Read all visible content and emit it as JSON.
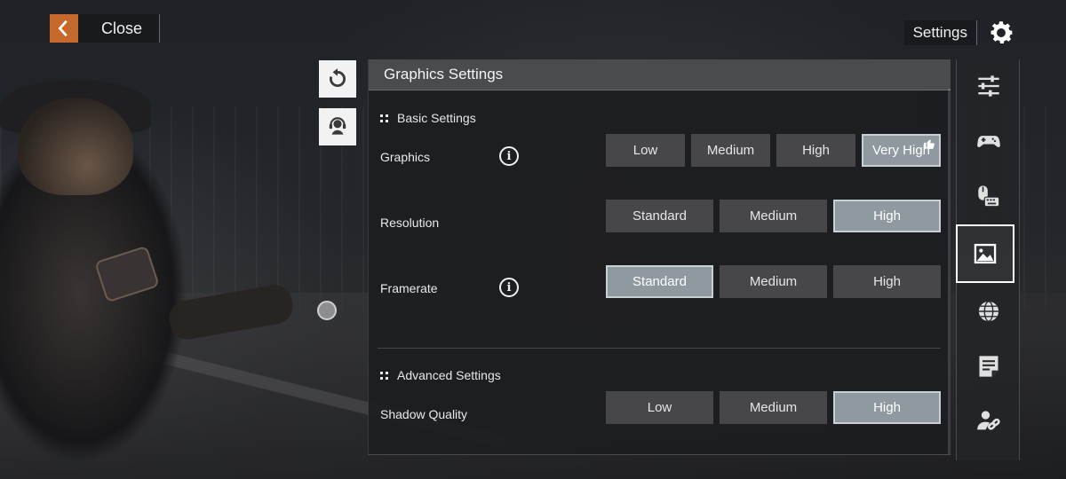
{
  "top_bar": {
    "close_label": "Close",
    "settings_label": "Settings"
  },
  "panel": {
    "title": "Graphics Settings",
    "basic_section": "Basic Settings",
    "advanced_section": "Advanced Settings",
    "info_glyph": "i",
    "rows": {
      "graphics": {
        "label": "Graphics",
        "options": [
          "Low",
          "Medium",
          "High",
          "Very High"
        ],
        "selected": "Very High",
        "recommended": "Very High"
      },
      "resolution": {
        "label": "Resolution",
        "options": [
          "Standard",
          "Medium",
          "High"
        ],
        "selected": "High"
      },
      "framerate": {
        "label": "Framerate",
        "options": [
          "Standard",
          "Medium",
          "High"
        ],
        "selected": "Standard"
      },
      "shadow": {
        "label": "Shadow Quality",
        "options": [
          "Low",
          "Medium",
          "High"
        ],
        "selected": "High"
      }
    }
  },
  "nav": {
    "items": [
      "sliders-icon",
      "gamepad-icon",
      "mouse-keyboard-icon",
      "image-icon",
      "globe-icon",
      "document-icon",
      "account-link-icon"
    ],
    "active": "image-icon"
  },
  "colors": {
    "accent": "#c4692b",
    "selected_option": "#8e9aa0",
    "option": "#474749",
    "header": "#4a4b4d"
  }
}
